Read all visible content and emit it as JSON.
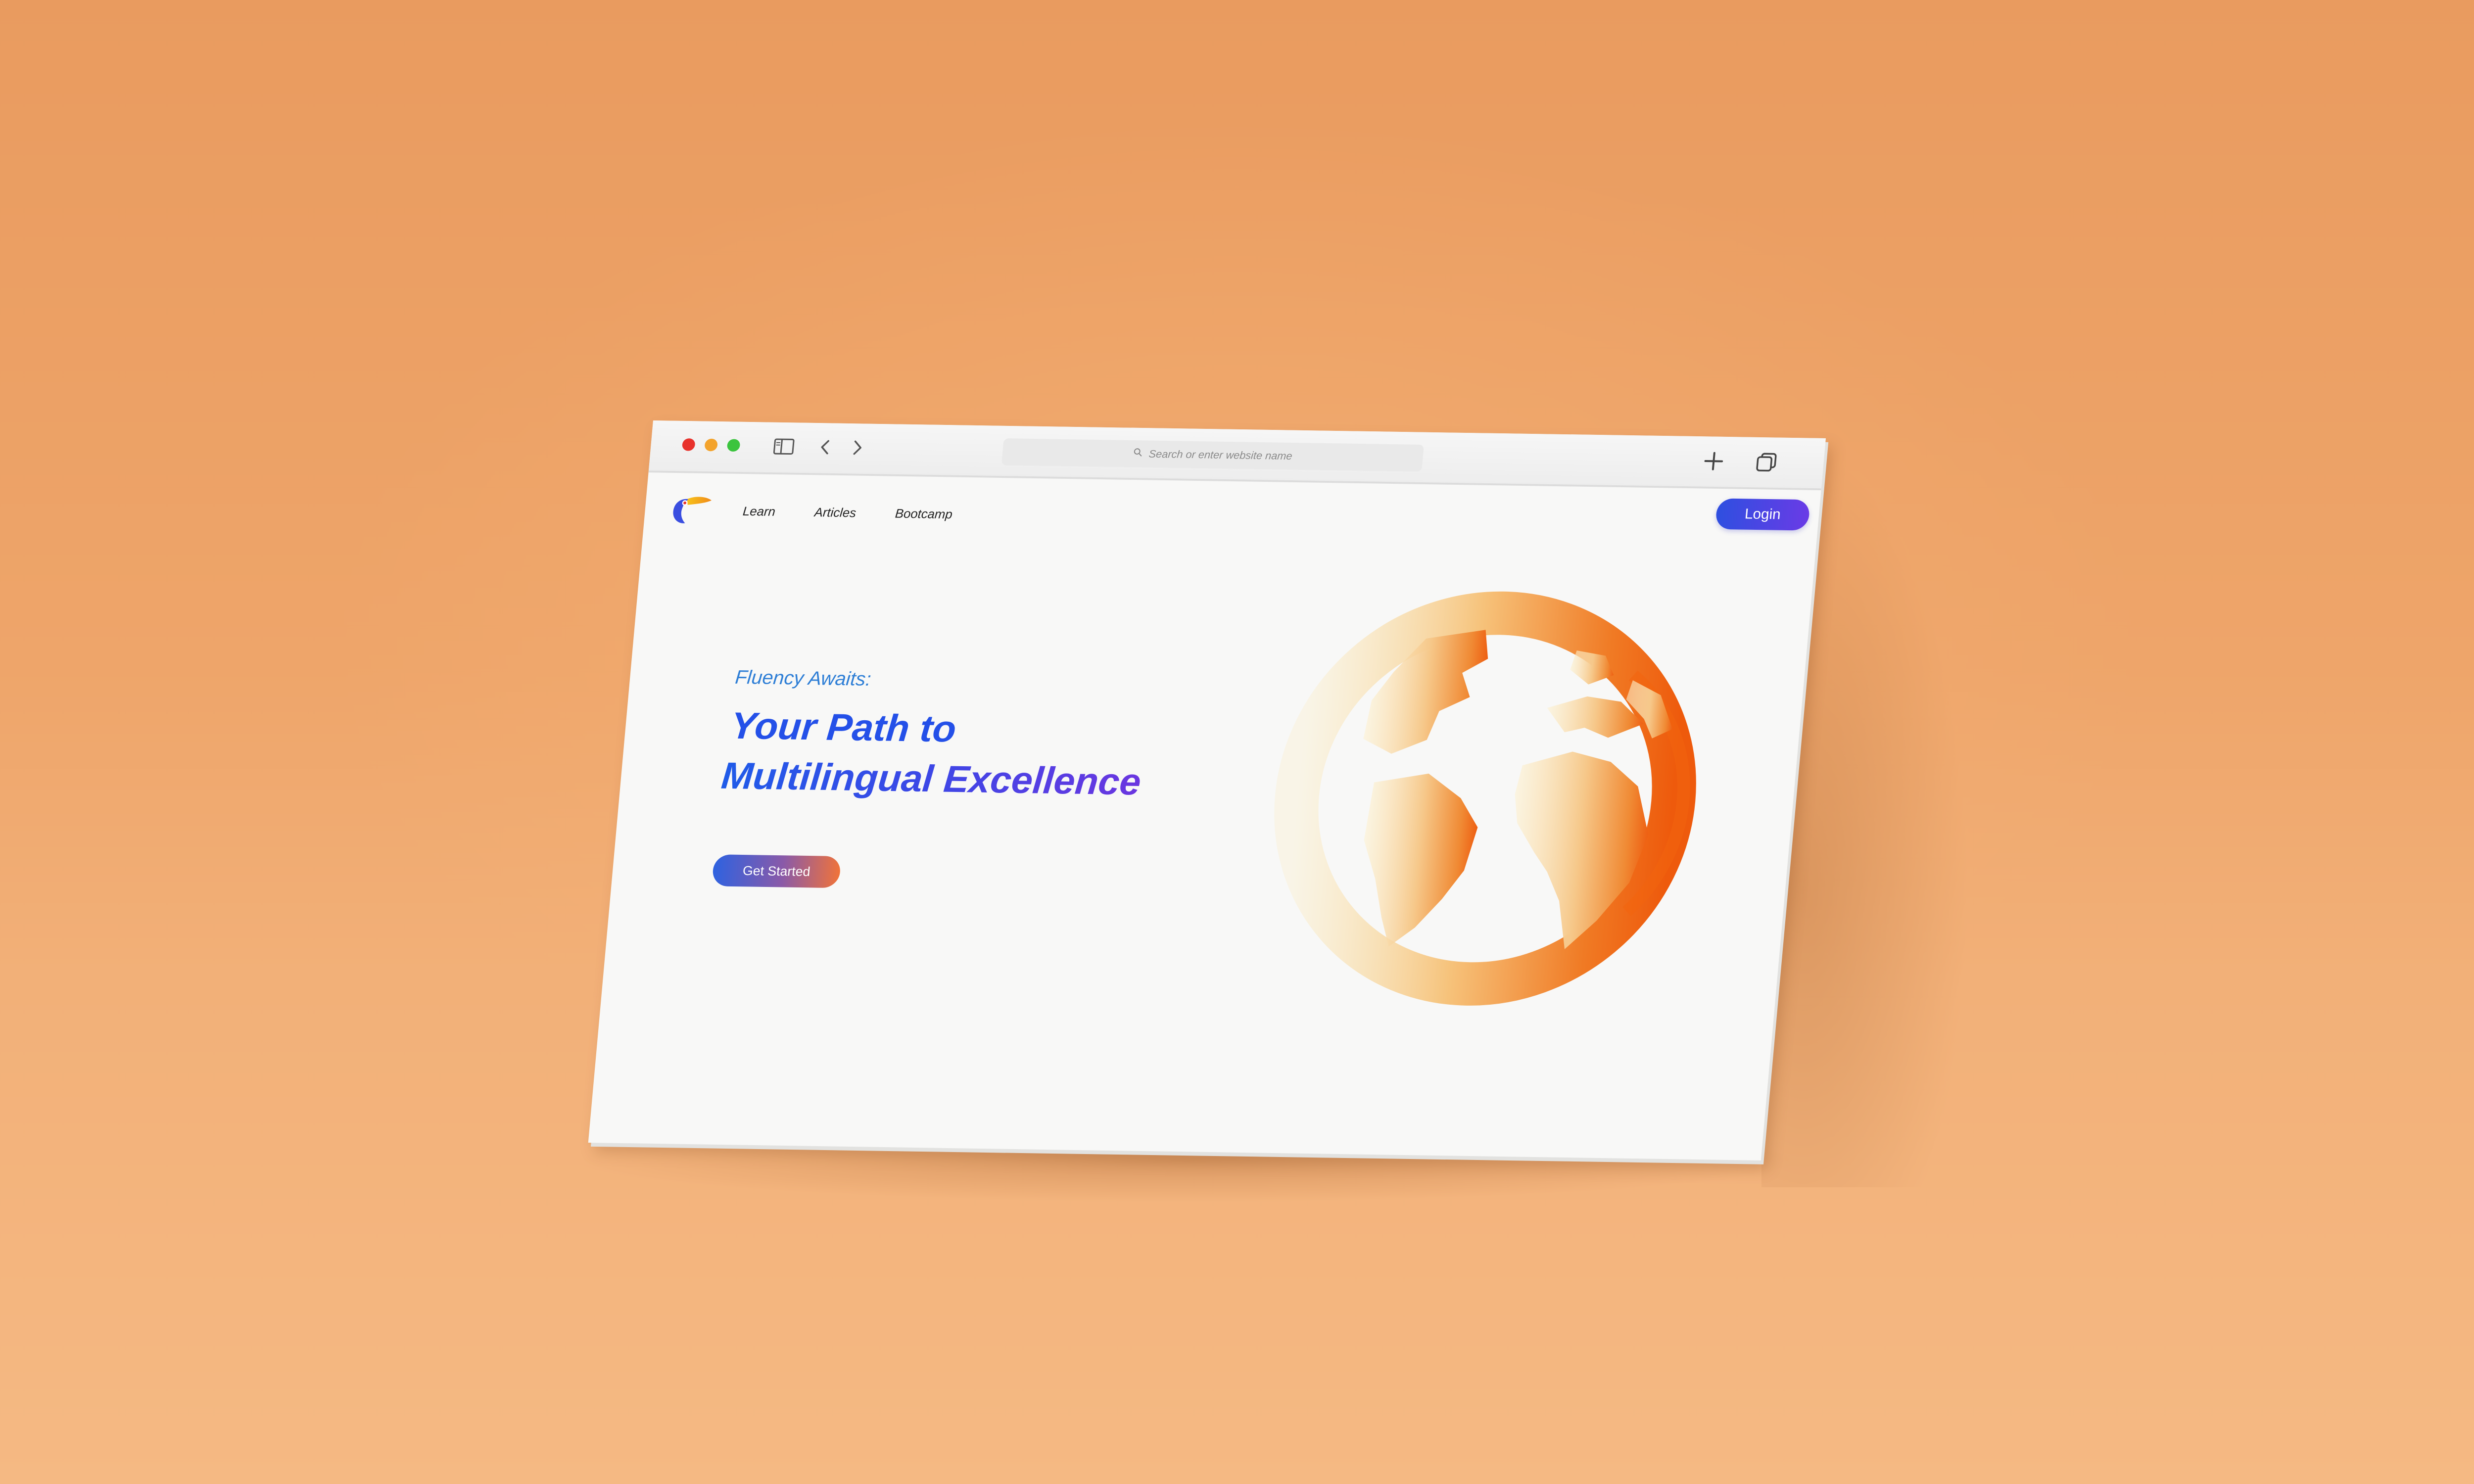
{
  "browser": {
    "address_placeholder": "Search or enter website name",
    "toolbar_icons": [
      "sidebar-icon",
      "chevron-left-icon",
      "chevron-right-icon",
      "plus-icon",
      "tabs-icon"
    ]
  },
  "site": {
    "logo": "toucan-logo-icon",
    "nav": [
      {
        "label": "Learn"
      },
      {
        "label": "Articles"
      },
      {
        "label": "Bootcamp"
      }
    ],
    "login_label": "Login"
  },
  "hero": {
    "eyebrow": "Fluency Awaits:",
    "headline_line1": "Your Path to",
    "headline_line2": "Multilingual Excellence",
    "cta_label": "Get Started",
    "illustration": "globe-icon"
  },
  "colors": {
    "background": "#eca366",
    "primary_blue": "#2450e8",
    "accent_purple": "#6a36e0",
    "accent_orange": "#f06010",
    "eyebrow_blue": "#2f7fd6"
  }
}
